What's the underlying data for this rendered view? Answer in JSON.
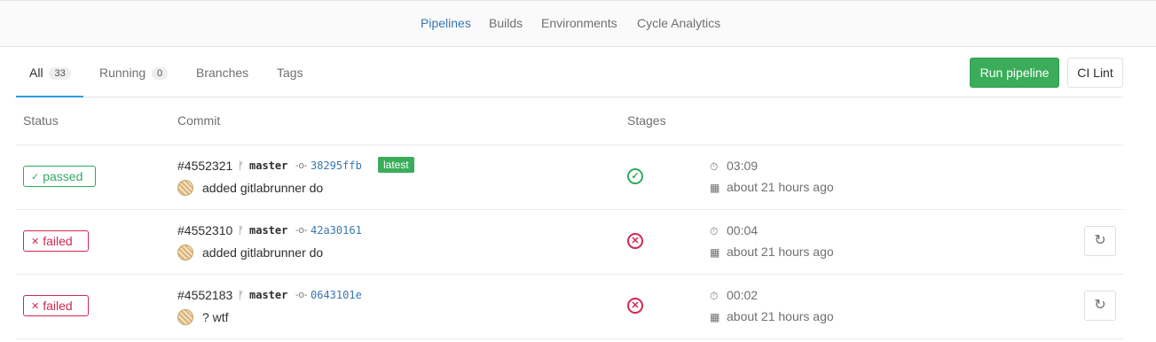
{
  "subnav": {
    "items": [
      "Pipelines",
      "Builds",
      "Environments",
      "Cycle Analytics"
    ],
    "active": "Pipelines"
  },
  "tabs": [
    {
      "label": "All",
      "count": "33"
    },
    {
      "label": "Running",
      "count": "0"
    },
    {
      "label": "Branches"
    },
    {
      "label": "Tags"
    }
  ],
  "buttons": {
    "run_pipeline": "Run pipeline",
    "ci_lint": "CI Lint"
  },
  "table": {
    "headers": {
      "status": "Status",
      "commit": "Commit",
      "stages": "Stages"
    },
    "rows": [
      {
        "status": "passed",
        "status_icon": "✓",
        "id": "#4552321",
        "branch": "master",
        "sha": "38295ffb",
        "latest": "latest",
        "message": "added gitlabrunner do",
        "stage_icon": "✓",
        "duration": "03:09",
        "finished": "about 21 hours ago"
      },
      {
        "status": "failed",
        "status_icon": "✕",
        "id": "#4552310",
        "branch": "master",
        "sha": "42a30161",
        "message": "added gitlabrunner do",
        "stage_icon": "✕",
        "duration": "00:04",
        "finished": "about 21 hours ago",
        "retry_icon": "↻"
      },
      {
        "status": "failed",
        "status_icon": "✕",
        "id": "#4552183",
        "branch": "master",
        "sha": "0643101e",
        "message": "? wtf",
        "stage_icon": "✕",
        "duration": "00:02",
        "finished": "about 21 hours ago",
        "retry_icon": "↻"
      }
    ]
  },
  "icons": {
    "branch": "branch-icon",
    "commit": "commit-icon",
    "timer": "timer-icon",
    "calendar": "calendar-icon",
    "retry": "retry-icon"
  },
  "colors": {
    "passed": "#2faa60",
    "failed": "#d22852",
    "link": "#3777b0",
    "primary": "#3bad5a"
  }
}
